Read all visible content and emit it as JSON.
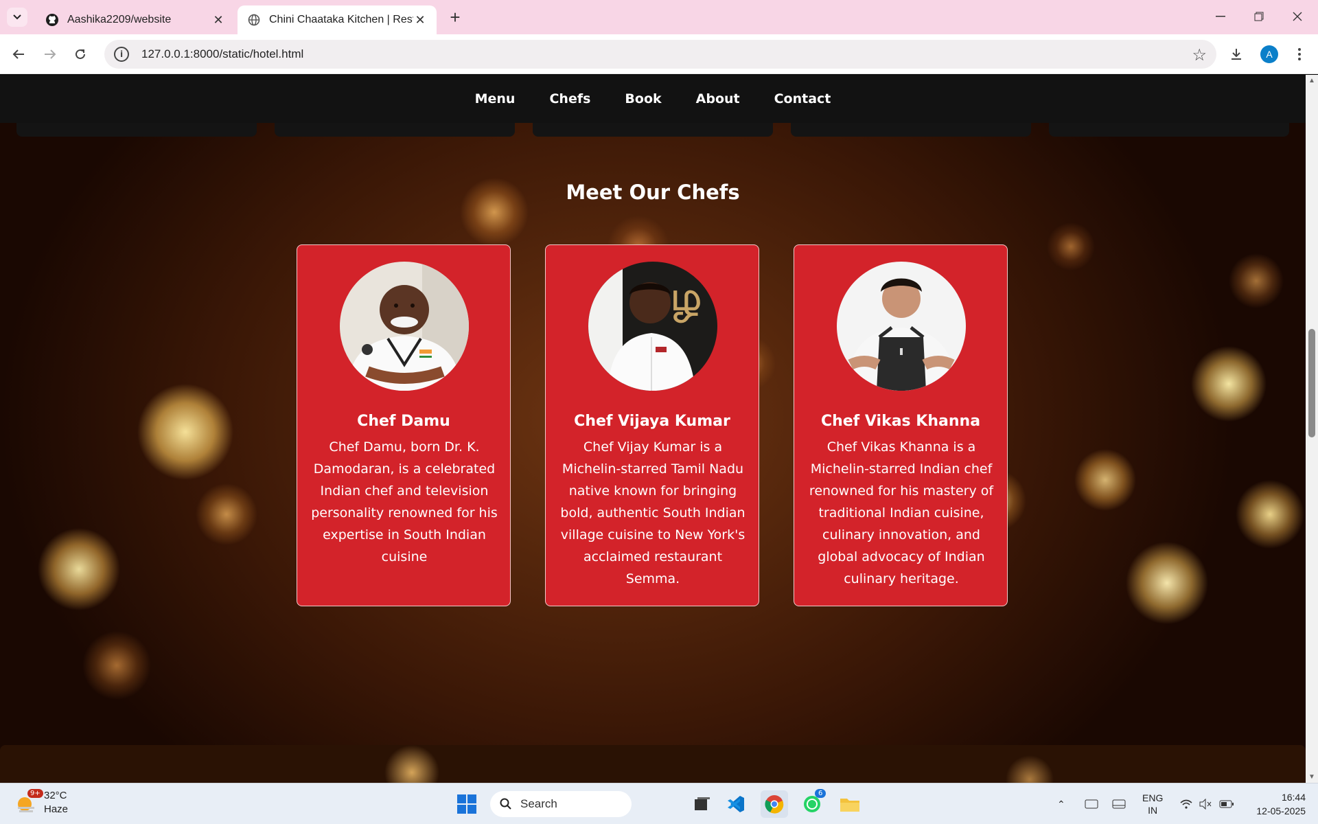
{
  "browser": {
    "tabs": [
      {
        "title": "Aashika2209/website",
        "active": false,
        "icon": "github-icon"
      },
      {
        "title": "Chini Chaataka Kitchen | Restau",
        "active": true,
        "icon": "globe-icon"
      }
    ],
    "url": "127.0.0.1:8000/static/hotel.html",
    "profile_initial": "A"
  },
  "site": {
    "nav": [
      "Menu",
      "Chefs",
      "Book",
      "About",
      "Contact"
    ],
    "section_title": "Meet Our Chefs",
    "chefs": [
      {
        "name": "Chef Damu",
        "description": "Chef Damu, born Dr. K. Damodaran, is a celebrated Indian chef and television personality renowned for his expertise in South Indian cuisine"
      },
      {
        "name": "Chef Vijaya Kumar",
        "description": "Chef Vijay Kumar is a Michelin-starred Tamil Nadu native known for bringing bold, authentic South Indian village cuisine to New York's acclaimed restaurant Semma."
      },
      {
        "name": "Chef Vikas Khanna",
        "description": "Chef Vikas Khanna is a Michelin-starred Indian chef renowned for his mastery of traditional Indian cuisine, culinary innovation, and global advocacy of Indian culinary heritage."
      }
    ],
    "colors": {
      "card": "#d3232a",
      "nav": "#121212"
    }
  },
  "taskbar": {
    "weather": {
      "temp": "32°C",
      "condition": "Haze",
      "badge": "9+"
    },
    "search_placeholder": "Search",
    "whatsapp_badge": "6",
    "lang_line1": "ENG",
    "lang_line2": "IN",
    "time": "16:44",
    "date": "12-05-2025"
  }
}
